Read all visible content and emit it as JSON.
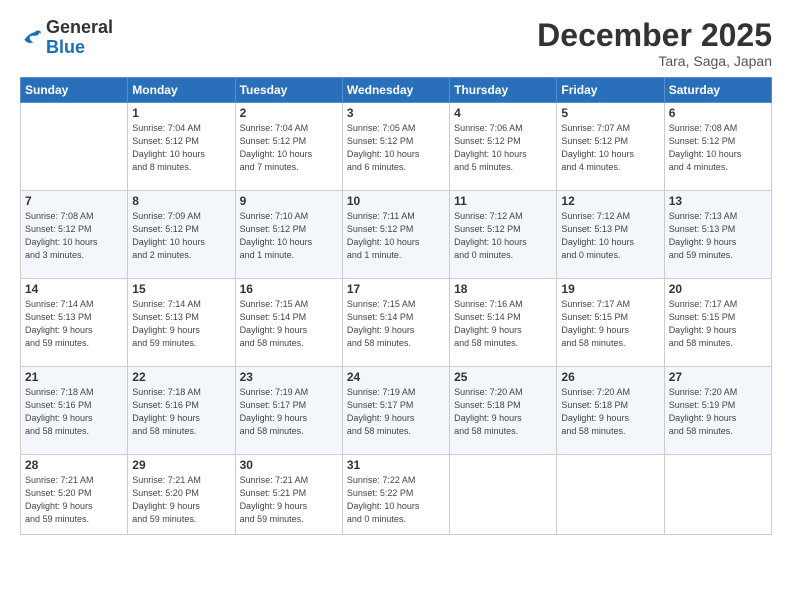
{
  "logo": {
    "general": "General",
    "blue": "Blue"
  },
  "header": {
    "month_year": "December 2025",
    "location": "Tara, Saga, Japan"
  },
  "weekdays": [
    "Sunday",
    "Monday",
    "Tuesday",
    "Wednesday",
    "Thursday",
    "Friday",
    "Saturday"
  ],
  "weeks": [
    [
      {
        "day": "",
        "info": ""
      },
      {
        "day": "1",
        "info": "Sunrise: 7:04 AM\nSunset: 5:12 PM\nDaylight: 10 hours\nand 8 minutes."
      },
      {
        "day": "2",
        "info": "Sunrise: 7:04 AM\nSunset: 5:12 PM\nDaylight: 10 hours\nand 7 minutes."
      },
      {
        "day": "3",
        "info": "Sunrise: 7:05 AM\nSunset: 5:12 PM\nDaylight: 10 hours\nand 6 minutes."
      },
      {
        "day": "4",
        "info": "Sunrise: 7:06 AM\nSunset: 5:12 PM\nDaylight: 10 hours\nand 5 minutes."
      },
      {
        "day": "5",
        "info": "Sunrise: 7:07 AM\nSunset: 5:12 PM\nDaylight: 10 hours\nand 4 minutes."
      },
      {
        "day": "6",
        "info": "Sunrise: 7:08 AM\nSunset: 5:12 PM\nDaylight: 10 hours\nand 4 minutes."
      }
    ],
    [
      {
        "day": "7",
        "info": "Sunrise: 7:08 AM\nSunset: 5:12 PM\nDaylight: 10 hours\nand 3 minutes."
      },
      {
        "day": "8",
        "info": "Sunrise: 7:09 AM\nSunset: 5:12 PM\nDaylight: 10 hours\nand 2 minutes."
      },
      {
        "day": "9",
        "info": "Sunrise: 7:10 AM\nSunset: 5:12 PM\nDaylight: 10 hours\nand 1 minute."
      },
      {
        "day": "10",
        "info": "Sunrise: 7:11 AM\nSunset: 5:12 PM\nDaylight: 10 hours\nand 1 minute."
      },
      {
        "day": "11",
        "info": "Sunrise: 7:12 AM\nSunset: 5:12 PM\nDaylight: 10 hours\nand 0 minutes."
      },
      {
        "day": "12",
        "info": "Sunrise: 7:12 AM\nSunset: 5:13 PM\nDaylight: 10 hours\nand 0 minutes."
      },
      {
        "day": "13",
        "info": "Sunrise: 7:13 AM\nSunset: 5:13 PM\nDaylight: 9 hours\nand 59 minutes."
      }
    ],
    [
      {
        "day": "14",
        "info": "Sunrise: 7:14 AM\nSunset: 5:13 PM\nDaylight: 9 hours\nand 59 minutes."
      },
      {
        "day": "15",
        "info": "Sunrise: 7:14 AM\nSunset: 5:13 PM\nDaylight: 9 hours\nand 59 minutes."
      },
      {
        "day": "16",
        "info": "Sunrise: 7:15 AM\nSunset: 5:14 PM\nDaylight: 9 hours\nand 58 minutes."
      },
      {
        "day": "17",
        "info": "Sunrise: 7:15 AM\nSunset: 5:14 PM\nDaylight: 9 hours\nand 58 minutes."
      },
      {
        "day": "18",
        "info": "Sunrise: 7:16 AM\nSunset: 5:14 PM\nDaylight: 9 hours\nand 58 minutes."
      },
      {
        "day": "19",
        "info": "Sunrise: 7:17 AM\nSunset: 5:15 PM\nDaylight: 9 hours\nand 58 minutes."
      },
      {
        "day": "20",
        "info": "Sunrise: 7:17 AM\nSunset: 5:15 PM\nDaylight: 9 hours\nand 58 minutes."
      }
    ],
    [
      {
        "day": "21",
        "info": "Sunrise: 7:18 AM\nSunset: 5:16 PM\nDaylight: 9 hours\nand 58 minutes."
      },
      {
        "day": "22",
        "info": "Sunrise: 7:18 AM\nSunset: 5:16 PM\nDaylight: 9 hours\nand 58 minutes."
      },
      {
        "day": "23",
        "info": "Sunrise: 7:19 AM\nSunset: 5:17 PM\nDaylight: 9 hours\nand 58 minutes."
      },
      {
        "day": "24",
        "info": "Sunrise: 7:19 AM\nSunset: 5:17 PM\nDaylight: 9 hours\nand 58 minutes."
      },
      {
        "day": "25",
        "info": "Sunrise: 7:20 AM\nSunset: 5:18 PM\nDaylight: 9 hours\nand 58 minutes."
      },
      {
        "day": "26",
        "info": "Sunrise: 7:20 AM\nSunset: 5:18 PM\nDaylight: 9 hours\nand 58 minutes."
      },
      {
        "day": "27",
        "info": "Sunrise: 7:20 AM\nSunset: 5:19 PM\nDaylight: 9 hours\nand 58 minutes."
      }
    ],
    [
      {
        "day": "28",
        "info": "Sunrise: 7:21 AM\nSunset: 5:20 PM\nDaylight: 9 hours\nand 59 minutes."
      },
      {
        "day": "29",
        "info": "Sunrise: 7:21 AM\nSunset: 5:20 PM\nDaylight: 9 hours\nand 59 minutes."
      },
      {
        "day": "30",
        "info": "Sunrise: 7:21 AM\nSunset: 5:21 PM\nDaylight: 9 hours\nand 59 minutes."
      },
      {
        "day": "31",
        "info": "Sunrise: 7:22 AM\nSunset: 5:22 PM\nDaylight: 10 hours\nand 0 minutes."
      },
      {
        "day": "",
        "info": ""
      },
      {
        "day": "",
        "info": ""
      },
      {
        "day": "",
        "info": ""
      }
    ]
  ]
}
